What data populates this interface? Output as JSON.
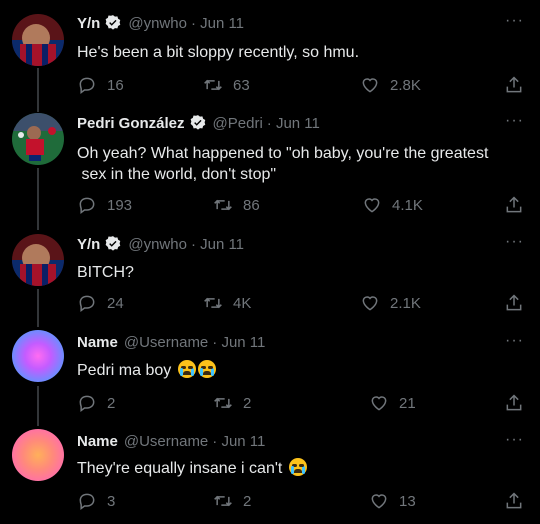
{
  "tweets": [
    {
      "name": "Y/n",
      "handle": "@ynwho",
      "date": "· Jun 11",
      "verified": true,
      "lines": [
        "He's been a bit sloppy recently, so hmu."
      ],
      "replies": "16",
      "retweets": "63",
      "likes": "2.8K"
    },
    {
      "name": "Pedri González",
      "handle": "@Pedri",
      "date": "· Jun 11",
      "verified": true,
      "lines": [
        "Oh yeah? What happened to \"oh baby, you're the greatest",
        " sex in the world, don't stop\""
      ],
      "replies": "193",
      "retweets": "86",
      "likes": "4.1K"
    },
    {
      "name": "Y/n",
      "handle": "@ynwho",
      "date": "· Jun 11",
      "verified": true,
      "lines": [
        "BITCH?"
      ],
      "replies": "24",
      "retweets": "4K",
      "likes": "2.1K"
    },
    {
      "name": "Name",
      "handle": "@Username",
      "date": "· Jun 11",
      "verified": false,
      "lines": [
        "Pedri ma boy"
      ],
      "replies": "2",
      "retweets": "2",
      "likes": "21"
    },
    {
      "name": "Name",
      "handle": "@Username",
      "date": "· Jun 11",
      "verified": false,
      "lines": [
        "They're equally insane i can't"
      ],
      "replies": "3",
      "retweets": "2",
      "likes": "13"
    }
  ],
  "more_label": "···",
  "colors": {
    "background": "#000000",
    "text": "#e7e9ea",
    "muted": "#71767b",
    "verified": "#1d9bf0"
  }
}
